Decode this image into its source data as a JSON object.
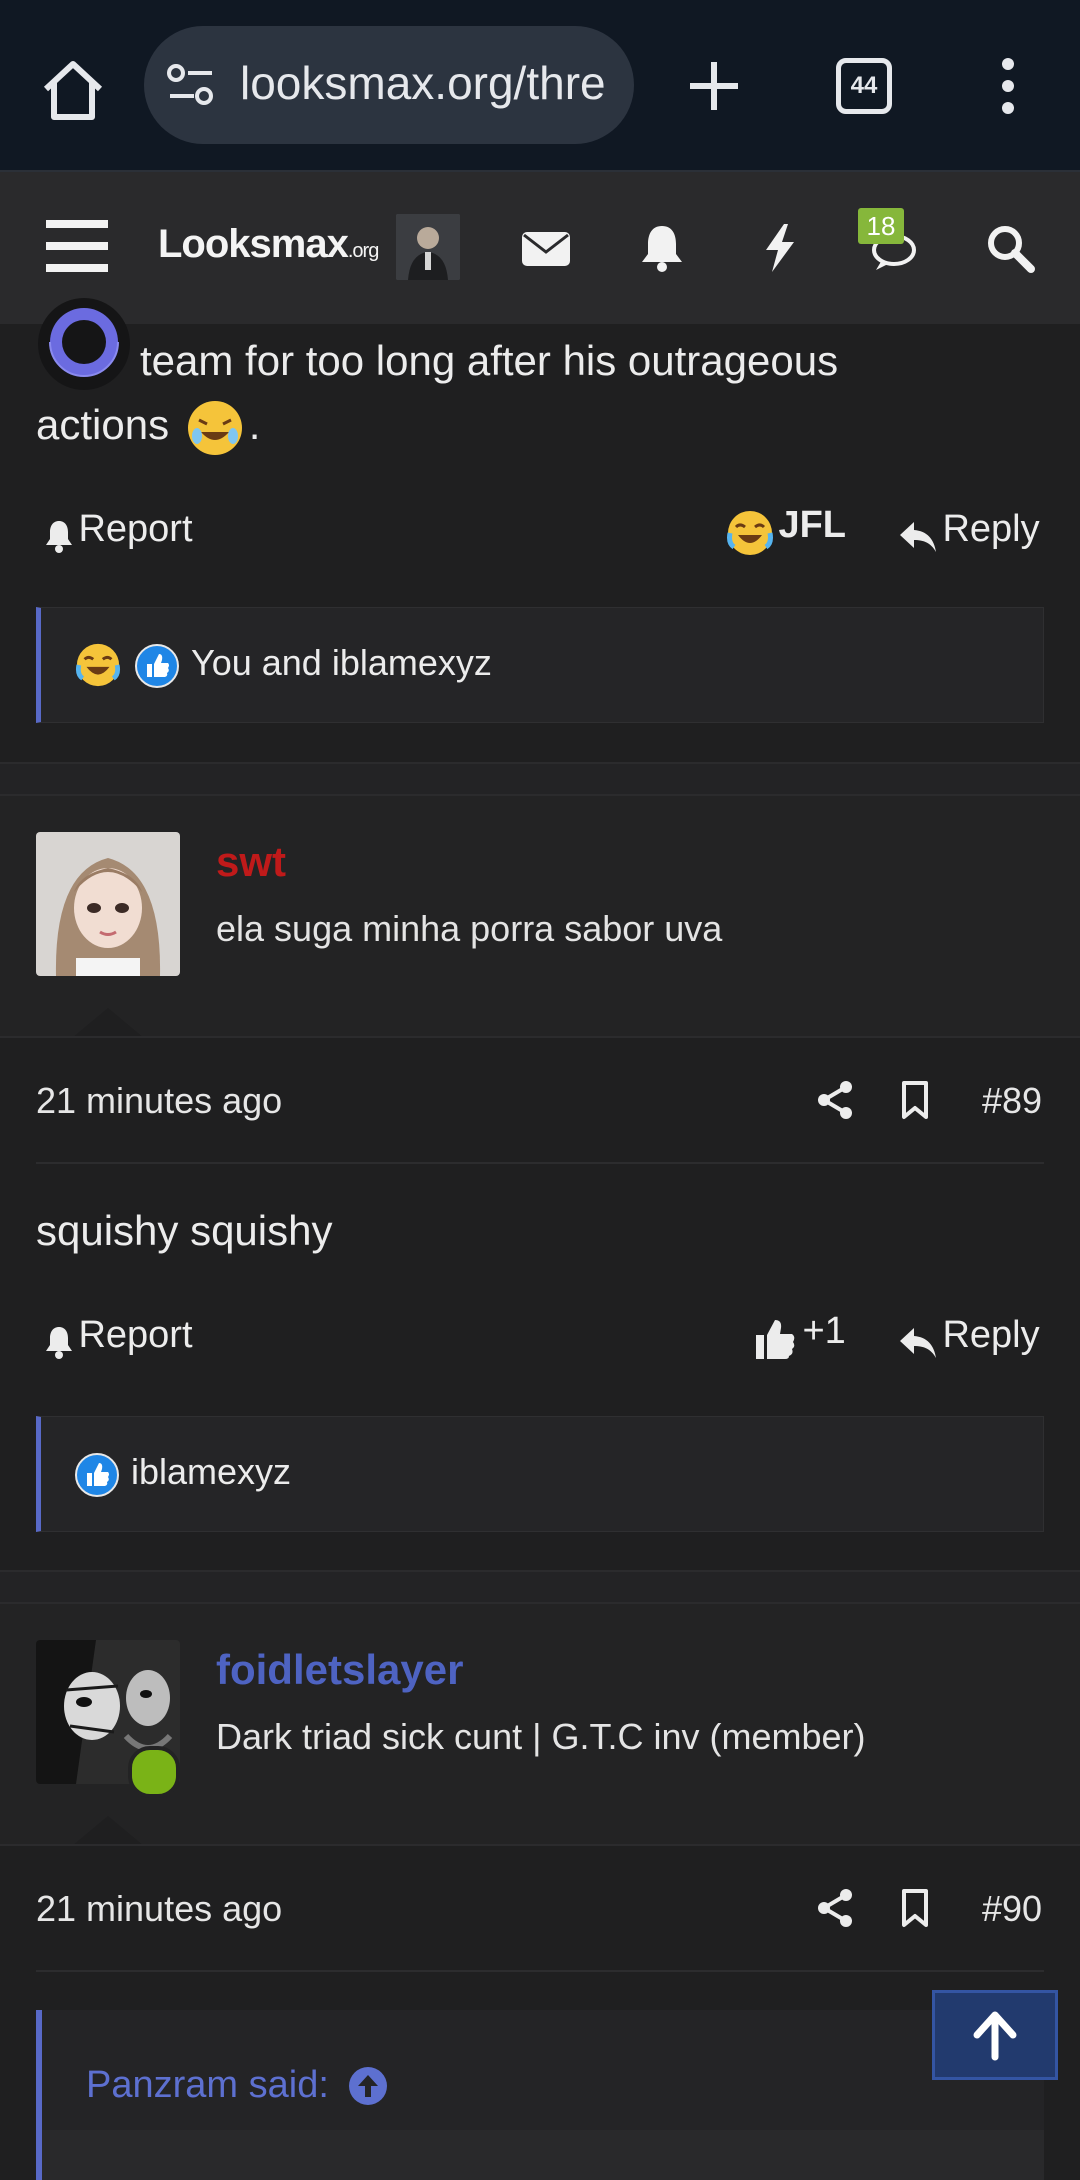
{
  "browser": {
    "url": "looksmax.org/thre",
    "tab_count": "44"
  },
  "site": {
    "logo_main": "Looksmax",
    "logo_suffix": ".org",
    "conversations_badge": "18"
  },
  "post_top": {
    "text_line1": "team for too long after his outrageous",
    "text_line2": "actions",
    "text_end": ".",
    "report_label": "Report",
    "reaction_label": "JFL",
    "reply_label": "Reply",
    "reactions_summary": "You and iblamexyz"
  },
  "post_89": {
    "username": "swt",
    "username_color": "#c01a1a",
    "user_title": "ela suga minha porra sabor uva",
    "time": "21 minutes ago",
    "number": "#89",
    "body": "squishy squishy",
    "report_label": "Report",
    "like_label": "+1",
    "reply_label": "Reply",
    "reactions_summary": "iblamexyz"
  },
  "post_90": {
    "username": "foidletslayer",
    "username_color": "#4e63c2",
    "user_title": "Dark triad sick cunt | G.T.C inv (member)",
    "time": "21 minutes ago",
    "number": "#90",
    "quote_author": "Panzram said:"
  },
  "colors": {
    "accent": "#5869c7",
    "online": "#7ab317"
  }
}
